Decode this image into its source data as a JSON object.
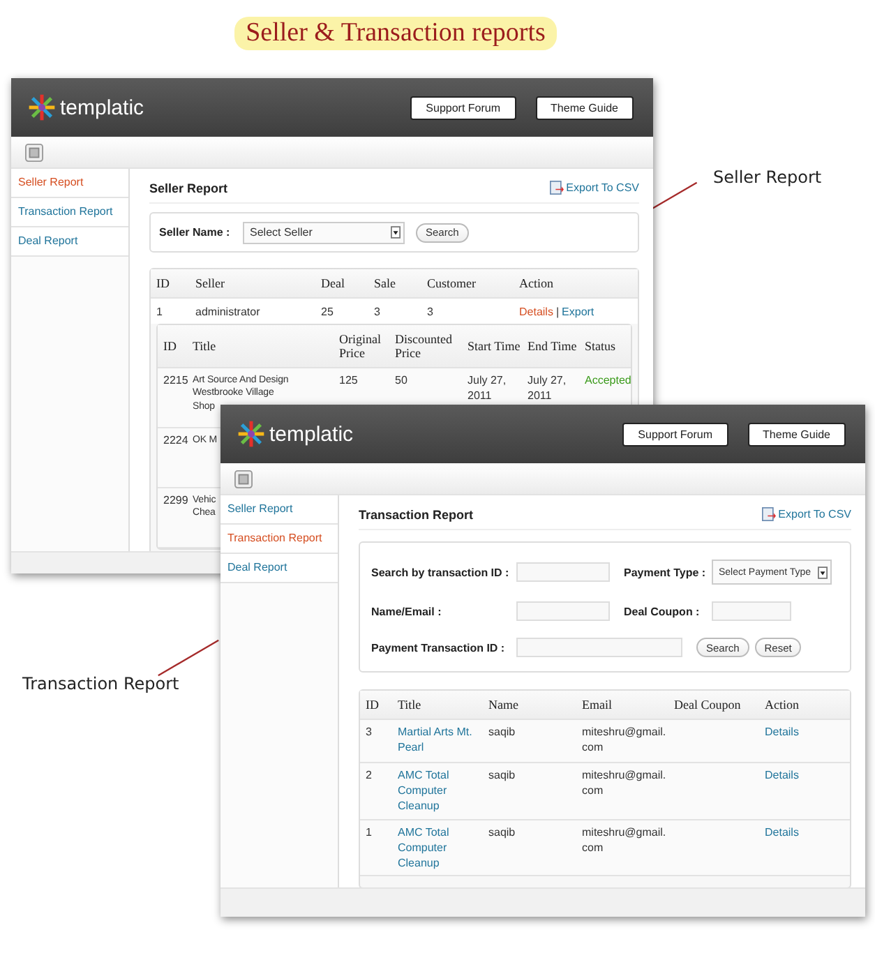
{
  "title": "Seller & Transaction reports",
  "callouts": [
    {
      "text": "Seller Report"
    },
    {
      "text": "Transaction Report"
    }
  ],
  "seller_window": {
    "logo": "templatic",
    "header_buttons": [
      "Support Forum",
      "Theme Guide"
    ],
    "sidebar": [
      {
        "label": "Seller Report",
        "selected": true
      },
      {
        "label": "Transaction Report",
        "selected": false
      },
      {
        "label": "Deal Report",
        "selected": false
      }
    ],
    "heading": "Seller Report",
    "export_link": "Export To CSV",
    "filter": {
      "label": "Seller Name :",
      "select": "Select Seller",
      "button": "Search"
    },
    "columns": [
      "ID",
      "Seller",
      "Deal",
      "Sale",
      "Customer",
      "Action"
    ],
    "rows": [
      {
        "id": "1",
        "seller": "administrator",
        "deal": "25",
        "sale": "3",
        "customer": "3",
        "separator": "|",
        "actions": [
          {
            "label": "Details",
            "color": "#d54e21"
          },
          {
            "label": "Export",
            "color": "#21759b"
          }
        ]
      }
    ],
    "detail_columns": [
      "ID",
      "Title",
      "Original Price",
      "Discounted Price",
      "Start Time",
      "End Time",
      "Status"
    ],
    "detail_rows": [
      {
        "id": "2215",
        "title": "Art Source And Design\nWestbrooke Village\nShop",
        "original_price": "125",
        "discounted_price": "50",
        "start_time": "July 27, 2011",
        "end_time": "July 27, 2011",
        "status": "Accepted"
      },
      {
        "id": "2224",
        "title": "OK M"
      },
      {
        "id": "2299",
        "title": "Vehic\nChea"
      }
    ]
  },
  "transaction_window": {
    "logo": "templatic",
    "header_buttons": [
      "Support Forum",
      "Theme Guide"
    ],
    "sidebar": [
      {
        "label": "Seller Report",
        "selected": false
      },
      {
        "label": "Transaction Report",
        "selected": true
      },
      {
        "label": "Deal Report",
        "selected": false
      }
    ],
    "heading": "Transaction Report",
    "export_link": "Export To CSV",
    "form_rows": [
      [
        {
          "label": "Search by transaction ID :",
          "kind": "text"
        },
        {
          "label": "Payment Type :",
          "kind": "select",
          "placeholder": "Select Payment Type"
        }
      ],
      [
        {
          "label": "Name/Email :",
          "kind": "text"
        },
        {
          "label": "Deal Coupon :",
          "kind": "text"
        }
      ],
      [
        {
          "label": "Payment Transaction ID :",
          "kind": "wide"
        }
      ]
    ],
    "form_buttons": [
      "Search",
      "Reset"
    ],
    "columns": [
      "ID",
      "Title",
      "Name",
      "Email",
      "Deal Coupon",
      "Action"
    ],
    "rows": [
      {
        "id": "3",
        "title": "Martial Arts Mt. Pearl",
        "name": "saqib",
        "email": "miteshru@gmail.com",
        "action": "Details"
      },
      {
        "id": "2",
        "title": "AMC Total Computer Cleanup",
        "name": "saqib",
        "email": "miteshru@gmail.com",
        "action": "Details"
      },
      {
        "id": "1",
        "title": "AMC Total Computer Cleanup",
        "name": "saqib",
        "email": "miteshru@gmail.com",
        "action": "Details"
      }
    ]
  }
}
